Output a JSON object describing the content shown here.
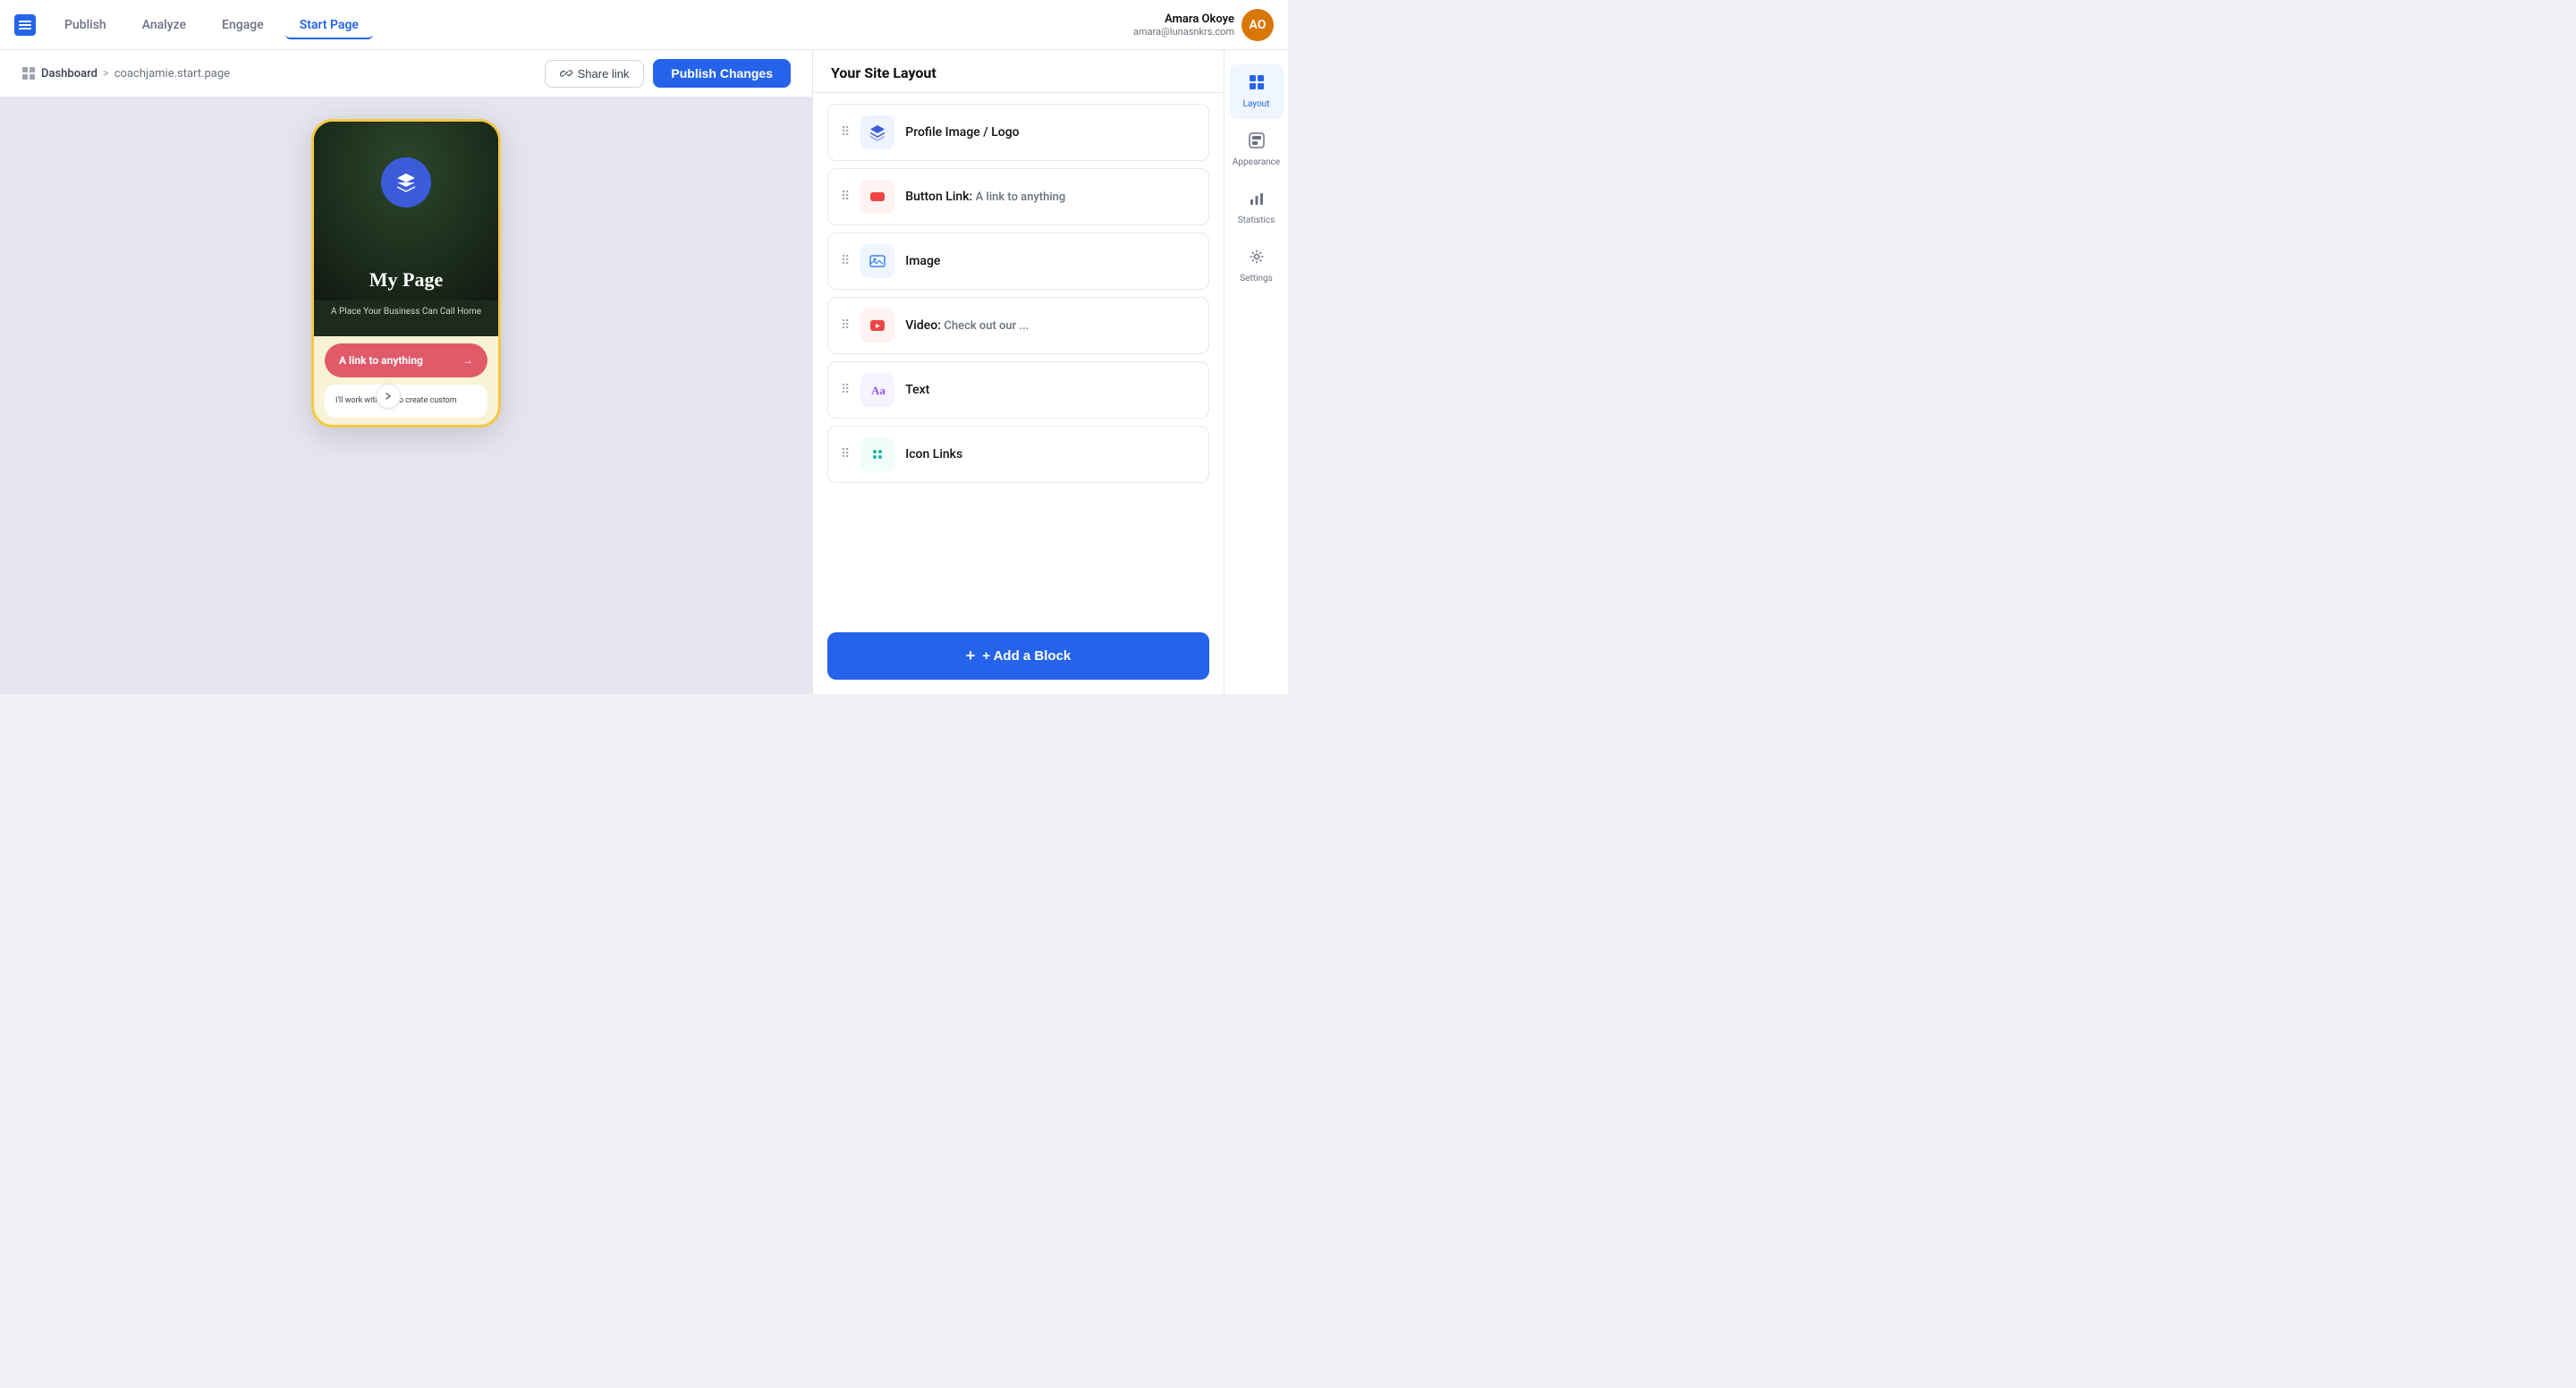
{
  "nav": {
    "logo_alt": "Buffer logo",
    "items": [
      {
        "id": "publish",
        "label": "Publish",
        "active": false
      },
      {
        "id": "analyze",
        "label": "Analyze",
        "active": false
      },
      {
        "id": "engage",
        "label": "Engage",
        "active": false
      },
      {
        "id": "start-page",
        "label": "Start Page",
        "active": true
      }
    ],
    "user": {
      "name": "Amara Okoye",
      "email": "amara@lunasnkrs.com",
      "avatar_initials": "AO"
    }
  },
  "breadcrumb": {
    "dashboard_label": "Dashboard",
    "separator": ">",
    "current_page": "coachjamie.start.page"
  },
  "actions": {
    "share_link_label": "Share link",
    "publish_changes_label": "Publish Changes"
  },
  "panel": {
    "title": "Your Site Layout",
    "items": [
      {
        "id": "profile-image-logo",
        "label": "Profile Image / Logo",
        "sublabel": "",
        "icon_color": "#3b5bdb",
        "icon_bg": "#eff3ff"
      },
      {
        "id": "button-link",
        "label": "Button Link:",
        "sublabel": "A link to anything",
        "icon_color": "#ef4444",
        "icon_bg": "#fef2f2"
      },
      {
        "id": "image",
        "label": "Image",
        "sublabel": "",
        "icon_color": "#3b82f6",
        "icon_bg": "#eff6ff"
      },
      {
        "id": "video",
        "label": "Video:",
        "sublabel": "Check out our ...",
        "icon_color": "#ef4444",
        "icon_bg": "#fef2f2"
      },
      {
        "id": "text",
        "label": "Text",
        "sublabel": "",
        "icon_color": "#8b5cf6",
        "icon_bg": "#f5f3ff"
      },
      {
        "id": "icon-links",
        "label": "Icon Links",
        "sublabel": "",
        "icon_color": "#14b8a6",
        "icon_bg": "#f0fdfa"
      }
    ],
    "add_block_label": "+ Add a Block"
  },
  "phone": {
    "title": "My Page",
    "subtitle": "A Place Your Business Can Call Home",
    "link_btn_label": "A link to anything",
    "text_preview": "I'll work with you to create custom"
  },
  "right_sidebar": {
    "items": [
      {
        "id": "layout",
        "label": "Layout",
        "active": true
      },
      {
        "id": "appearance",
        "label": "Appearance",
        "active": false
      },
      {
        "id": "statistics",
        "label": "Statistics",
        "active": false
      },
      {
        "id": "settings",
        "label": "Settings",
        "active": false
      }
    ]
  }
}
